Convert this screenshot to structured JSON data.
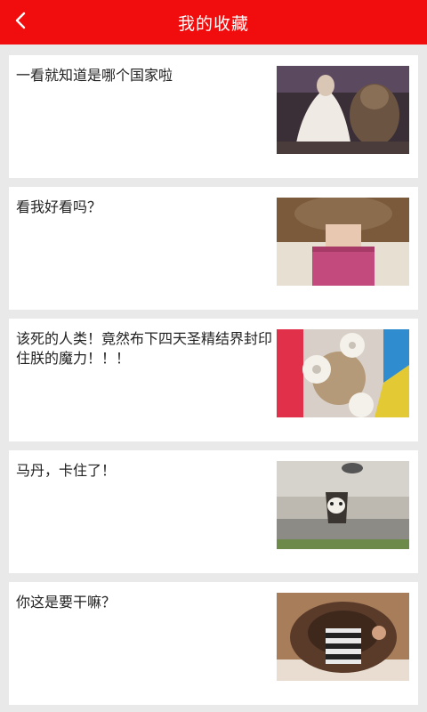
{
  "header": {
    "title": "我的收藏",
    "back_icon": "chevron-left-icon",
    "background": "#f10d0d"
  },
  "favorites": [
    {
      "text": "一看就知道是哪个国家啦"
    },
    {
      "text": "看我好看吗？"
    },
    {
      "text": "该死的人类！竟然布下四天圣精结界封印住朕的魔力！！！"
    },
    {
      "text": "马丹，卡住了！"
    },
    {
      "text": "你这是要干嘛？"
    }
  ]
}
